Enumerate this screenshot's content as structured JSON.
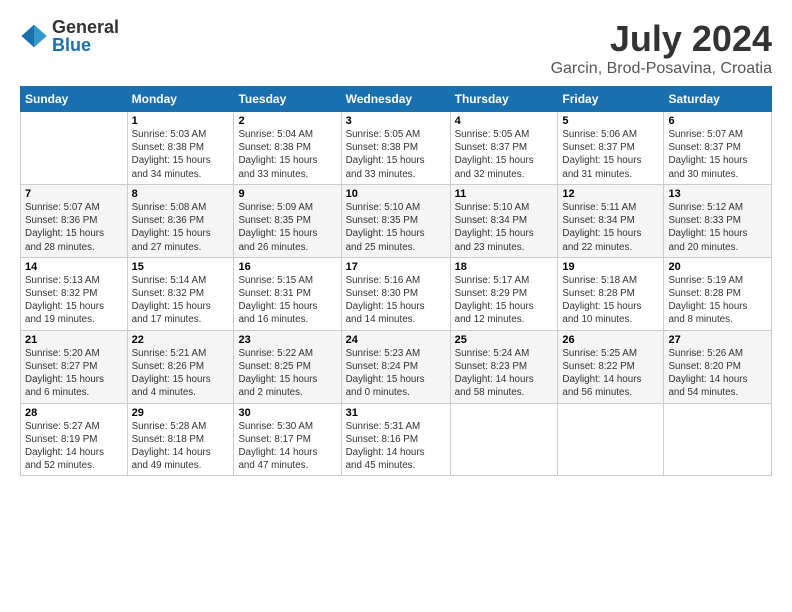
{
  "logo": {
    "general": "General",
    "blue": "Blue"
  },
  "title": "July 2024",
  "subtitle": "Garcin, Brod-Posavina, Croatia",
  "days_of_week": [
    "Sunday",
    "Monday",
    "Tuesday",
    "Wednesday",
    "Thursday",
    "Friday",
    "Saturday"
  ],
  "weeks": [
    [
      {
        "day": "",
        "info": ""
      },
      {
        "day": "1",
        "info": "Sunrise: 5:03 AM\nSunset: 8:38 PM\nDaylight: 15 hours\nand 34 minutes."
      },
      {
        "day": "2",
        "info": "Sunrise: 5:04 AM\nSunset: 8:38 PM\nDaylight: 15 hours\nand 33 minutes."
      },
      {
        "day": "3",
        "info": "Sunrise: 5:05 AM\nSunset: 8:38 PM\nDaylight: 15 hours\nand 33 minutes."
      },
      {
        "day": "4",
        "info": "Sunrise: 5:05 AM\nSunset: 8:37 PM\nDaylight: 15 hours\nand 32 minutes."
      },
      {
        "day": "5",
        "info": "Sunrise: 5:06 AM\nSunset: 8:37 PM\nDaylight: 15 hours\nand 31 minutes."
      },
      {
        "day": "6",
        "info": "Sunrise: 5:07 AM\nSunset: 8:37 PM\nDaylight: 15 hours\nand 30 minutes."
      }
    ],
    [
      {
        "day": "7",
        "info": "Sunrise: 5:07 AM\nSunset: 8:36 PM\nDaylight: 15 hours\nand 28 minutes."
      },
      {
        "day": "8",
        "info": "Sunrise: 5:08 AM\nSunset: 8:36 PM\nDaylight: 15 hours\nand 27 minutes."
      },
      {
        "day": "9",
        "info": "Sunrise: 5:09 AM\nSunset: 8:35 PM\nDaylight: 15 hours\nand 26 minutes."
      },
      {
        "day": "10",
        "info": "Sunrise: 5:10 AM\nSunset: 8:35 PM\nDaylight: 15 hours\nand 25 minutes."
      },
      {
        "day": "11",
        "info": "Sunrise: 5:10 AM\nSunset: 8:34 PM\nDaylight: 15 hours\nand 23 minutes."
      },
      {
        "day": "12",
        "info": "Sunrise: 5:11 AM\nSunset: 8:34 PM\nDaylight: 15 hours\nand 22 minutes."
      },
      {
        "day": "13",
        "info": "Sunrise: 5:12 AM\nSunset: 8:33 PM\nDaylight: 15 hours\nand 20 minutes."
      }
    ],
    [
      {
        "day": "14",
        "info": "Sunrise: 5:13 AM\nSunset: 8:32 PM\nDaylight: 15 hours\nand 19 minutes."
      },
      {
        "day": "15",
        "info": "Sunrise: 5:14 AM\nSunset: 8:32 PM\nDaylight: 15 hours\nand 17 minutes."
      },
      {
        "day": "16",
        "info": "Sunrise: 5:15 AM\nSunset: 8:31 PM\nDaylight: 15 hours\nand 16 minutes."
      },
      {
        "day": "17",
        "info": "Sunrise: 5:16 AM\nSunset: 8:30 PM\nDaylight: 15 hours\nand 14 minutes."
      },
      {
        "day": "18",
        "info": "Sunrise: 5:17 AM\nSunset: 8:29 PM\nDaylight: 15 hours\nand 12 minutes."
      },
      {
        "day": "19",
        "info": "Sunrise: 5:18 AM\nSunset: 8:28 PM\nDaylight: 15 hours\nand 10 minutes."
      },
      {
        "day": "20",
        "info": "Sunrise: 5:19 AM\nSunset: 8:28 PM\nDaylight: 15 hours\nand 8 minutes."
      }
    ],
    [
      {
        "day": "21",
        "info": "Sunrise: 5:20 AM\nSunset: 8:27 PM\nDaylight: 15 hours\nand 6 minutes."
      },
      {
        "day": "22",
        "info": "Sunrise: 5:21 AM\nSunset: 8:26 PM\nDaylight: 15 hours\nand 4 minutes."
      },
      {
        "day": "23",
        "info": "Sunrise: 5:22 AM\nSunset: 8:25 PM\nDaylight: 15 hours\nand 2 minutes."
      },
      {
        "day": "24",
        "info": "Sunrise: 5:23 AM\nSunset: 8:24 PM\nDaylight: 15 hours\nand 0 minutes."
      },
      {
        "day": "25",
        "info": "Sunrise: 5:24 AM\nSunset: 8:23 PM\nDaylight: 14 hours\nand 58 minutes."
      },
      {
        "day": "26",
        "info": "Sunrise: 5:25 AM\nSunset: 8:22 PM\nDaylight: 14 hours\nand 56 minutes."
      },
      {
        "day": "27",
        "info": "Sunrise: 5:26 AM\nSunset: 8:20 PM\nDaylight: 14 hours\nand 54 minutes."
      }
    ],
    [
      {
        "day": "28",
        "info": "Sunrise: 5:27 AM\nSunset: 8:19 PM\nDaylight: 14 hours\nand 52 minutes."
      },
      {
        "day": "29",
        "info": "Sunrise: 5:28 AM\nSunset: 8:18 PM\nDaylight: 14 hours\nand 49 minutes."
      },
      {
        "day": "30",
        "info": "Sunrise: 5:30 AM\nSunset: 8:17 PM\nDaylight: 14 hours\nand 47 minutes."
      },
      {
        "day": "31",
        "info": "Sunrise: 5:31 AM\nSunset: 8:16 PM\nDaylight: 14 hours\nand 45 minutes."
      },
      {
        "day": "",
        "info": ""
      },
      {
        "day": "",
        "info": ""
      },
      {
        "day": "",
        "info": ""
      }
    ]
  ]
}
